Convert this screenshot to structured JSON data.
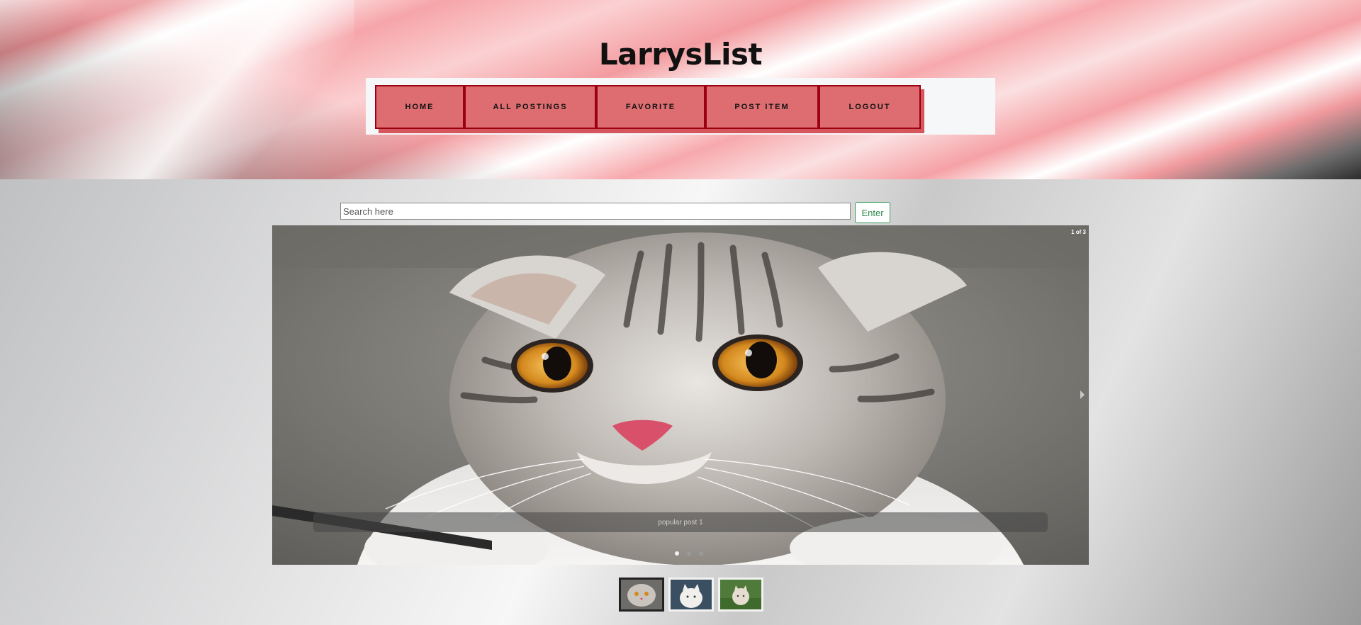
{
  "site": {
    "title": "LarrysList"
  },
  "nav": {
    "items": [
      {
        "label": "HOME"
      },
      {
        "label": "ALL POSTINGS"
      },
      {
        "label": "FAVORITE"
      },
      {
        "label": "POST ITEM"
      },
      {
        "label": "LOGOUT"
      }
    ]
  },
  "search": {
    "placeholder": "Search here",
    "value": "",
    "button_label": "Enter"
  },
  "carousel": {
    "counter": "1 of 3",
    "caption": "popular post 1",
    "slides": 3,
    "active_index": 0
  },
  "colors": {
    "nav_button": "#dd6d71",
    "nav_border": "#9b0010",
    "enter_button_text": "#2e8b4f",
    "cat_eye": "#d89a2a",
    "cat_nose": "#d9506a"
  }
}
